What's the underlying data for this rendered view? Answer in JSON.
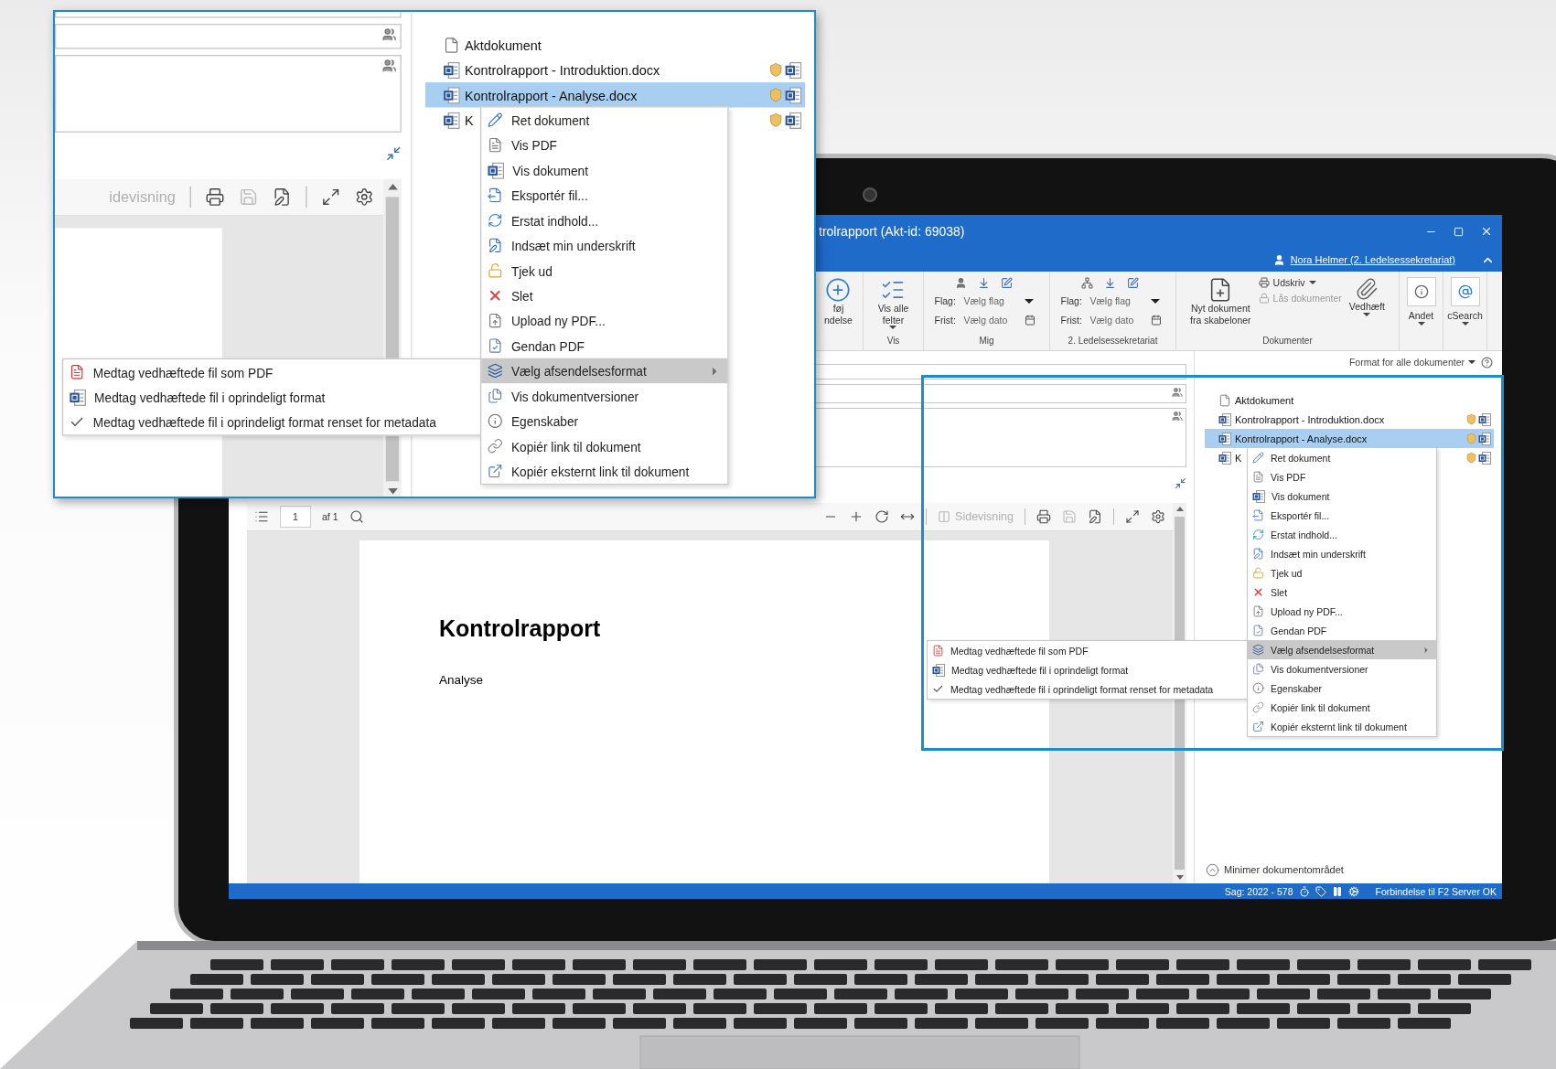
{
  "callout": {
    "viewer_toolbar": {
      "view_button": {
        "label": "idevisning",
        "disabled": true
      }
    },
    "documents": [
      {
        "name": "Aktdokument",
        "kind": "plain",
        "selected": false
      },
      {
        "name": "Kontrolrapport - Introduktion.docx",
        "kind": "word",
        "selected": false
      },
      {
        "name": "Kontrolrapport - Analyse.docx",
        "kind": "word",
        "selected": true
      },
      {
        "name": "K",
        "kind": "word",
        "selected": false
      }
    ],
    "context_menu": [
      {
        "label": "Ret dokument",
        "selected": false,
        "submenu": false
      },
      {
        "label": "Vis PDF",
        "selected": false,
        "submenu": false
      },
      {
        "label": "Vis dokument",
        "selected": false,
        "submenu": false
      },
      {
        "label": "Eksportér fil...",
        "selected": false,
        "submenu": false
      },
      {
        "label": "Erstat indhold...",
        "selected": false,
        "submenu": false
      },
      {
        "label": "Indsæt min underskrift",
        "selected": false,
        "submenu": false
      },
      {
        "label": "Tjek ud",
        "selected": false,
        "submenu": false
      },
      {
        "label": "Slet",
        "selected": false,
        "submenu": false
      },
      {
        "label": "Upload ny PDF...",
        "selected": false,
        "submenu": false
      },
      {
        "label": "Gendan PDF",
        "selected": false,
        "submenu": false
      },
      {
        "label": "Vælg afsendelsesformat",
        "selected": true,
        "submenu": true
      },
      {
        "label": "Vis dokumentversioner",
        "selected": false,
        "submenu": false
      },
      {
        "label": "Egenskaber",
        "selected": false,
        "submenu": false
      },
      {
        "label": "Kopiér link til dokument",
        "selected": false,
        "submenu": false
      },
      {
        "label": "Kopiér eksternt link til dokument",
        "selected": false,
        "submenu": false
      }
    ],
    "submenu": [
      {
        "label": "Medtag vedhæftede fil som PDF",
        "checked": false
      },
      {
        "label": "Medtag vedhæftede fil i oprindeligt format",
        "checked": false
      },
      {
        "label": "Medtag vedhæftede fil i oprindeligt format renset for metadata",
        "checked": true
      }
    ]
  },
  "window": {
    "title": "trolrapport (Akt-id: 69038)",
    "user": "Nora Helmer (2. Ledelsessekretariat)"
  },
  "ribbon": {
    "groups": [
      {
        "items": [
          {
            "kind": "large",
            "lines": [
              "føj",
              "ndelse"
            ],
            "dropdown": false
          }
        ]
      },
      {
        "label": "Vis",
        "items": [
          {
            "kind": "large",
            "lines": [
              "Vis alle",
              "felter"
            ],
            "dropdown": true
          }
        ]
      },
      {
        "label": "Mig",
        "items": [
          {
            "kind": "flags",
            "flag_label": "Flag:",
            "flag_value": "Vælg flag",
            "due_label": "Frist:",
            "due_value": "Vælg dato"
          }
        ]
      },
      {
        "label": "2. Ledelsessekretariat",
        "items": [
          {
            "kind": "flags",
            "flag_label": "Flag:",
            "flag_value": "Vælg flag",
            "due_label": "Frist:",
            "due_value": "Vælg dato"
          }
        ]
      },
      {
        "label": "Dokumenter",
        "items": [
          {
            "kind": "large",
            "lines": [
              "Nyt dokument",
              "fra skabeloner"
            ],
            "dropdown": false
          },
          {
            "kind": "stack",
            "entries": [
              {
                "label": "Udskriv",
                "dropdown": true,
                "disabled": false
              },
              {
                "label": "Lås dokumenter",
                "dropdown": false,
                "disabled": true
              }
            ]
          },
          {
            "kind": "large",
            "lines": [
              "Vedhæft"
            ],
            "dropdown": true
          }
        ]
      },
      {
        "items": [
          {
            "kind": "boxed",
            "lines": [
              "Andet"
            ],
            "dropdown": true
          }
        ]
      },
      {
        "items": [
          {
            "kind": "boxed",
            "lines": [
              "cSearch"
            ],
            "dropdown": true
          }
        ]
      }
    ]
  },
  "viewer": {
    "toolbar": {
      "page": "1",
      "page_count": "af 1",
      "view_button": {
        "label": "Sidevisning",
        "disabled": true
      }
    },
    "document": {
      "title": "Kontrolrapport",
      "subtitle": "Analyse"
    }
  },
  "document_panel": {
    "format_label": "Format for alle dokumenter",
    "documents": [
      {
        "name": "Aktdokument",
        "kind": "plain",
        "selected": false
      },
      {
        "name": "Kontrolrapport - Introduktion.docx",
        "kind": "word",
        "selected": false
      },
      {
        "name": "Kontrolrapport - Analyse.docx",
        "kind": "word",
        "selected": true
      },
      {
        "name": "K",
        "kind": "word",
        "selected": false
      }
    ],
    "context_menu": [
      {
        "label": "Ret dokument",
        "selected": false,
        "submenu": false
      },
      {
        "label": "Vis PDF",
        "selected": false,
        "submenu": false
      },
      {
        "label": "Vis dokument",
        "selected": false,
        "submenu": false
      },
      {
        "label": "Eksportér fil...",
        "selected": false,
        "submenu": false
      },
      {
        "label": "Erstat indhold...",
        "selected": false,
        "submenu": false
      },
      {
        "label": "Indsæt min underskrift",
        "selected": false,
        "submenu": false
      },
      {
        "label": "Tjek ud",
        "selected": false,
        "submenu": false
      },
      {
        "label": "Slet",
        "selected": false,
        "submenu": false
      },
      {
        "label": "Upload ny PDF...",
        "selected": false,
        "submenu": false
      },
      {
        "label": "Gendan PDF",
        "selected": false,
        "submenu": false
      },
      {
        "label": "Vælg afsendelsesformat",
        "selected": true,
        "submenu": true
      },
      {
        "label": "Vis dokumentversioner",
        "selected": false,
        "submenu": false
      },
      {
        "label": "Egenskaber",
        "selected": false,
        "submenu": false
      },
      {
        "label": "Kopiér link til dokument",
        "selected": false,
        "submenu": false
      },
      {
        "label": "Kopiér eksternt link til dokument",
        "selected": false,
        "submenu": false
      }
    ],
    "submenu": [
      {
        "label": "Medtag vedhæftede fil som PDF",
        "checked": false
      },
      {
        "label": "Medtag vedhæftede fil i oprindeligt format",
        "checked": false
      },
      {
        "label": "Medtag vedhæftede fil i oprindeligt format renset for metadata",
        "checked": true
      }
    ],
    "minimize_label": "Minimer dokumentområdet"
  },
  "status_bar": {
    "case": "Sag: 2022 - 578",
    "connection": "Forbindelse til F2 Server OK"
  }
}
